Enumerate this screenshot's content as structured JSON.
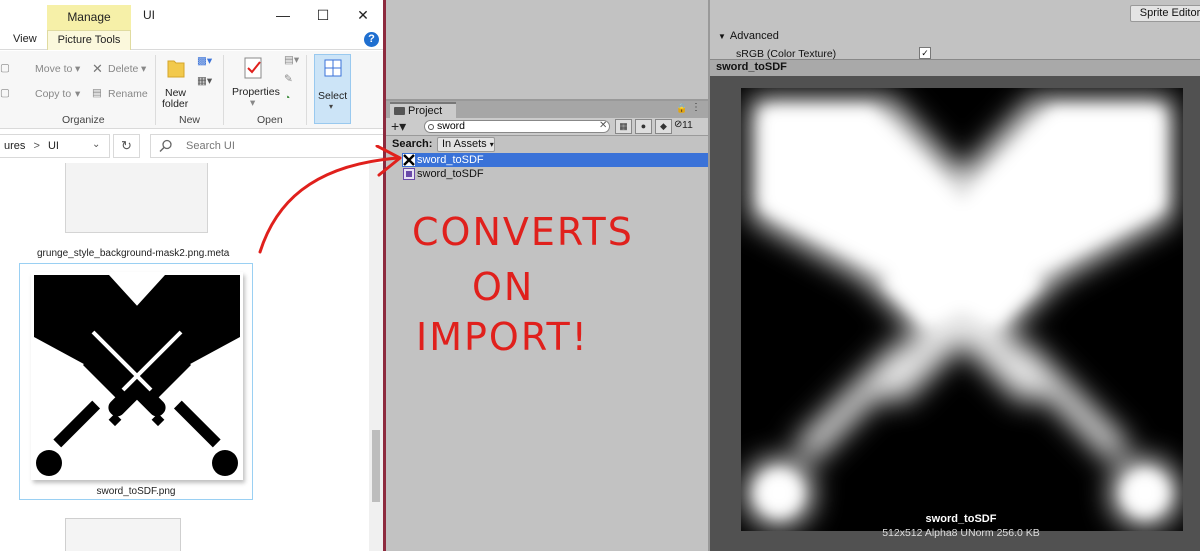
{
  "explorer": {
    "manage_tab": "Manage",
    "title": "UI",
    "tabs": {
      "view": "View",
      "picture_tools": "Picture Tools"
    },
    "ribbon": {
      "move_to": "Move to",
      "copy_to": "Copy to",
      "delete": "Delete",
      "rename": "Rename",
      "new_folder_line1": "New",
      "new_folder_line2": "folder",
      "properties": "Properties",
      "select": "Select",
      "groups": {
        "organize": "Organize",
        "new": "New",
        "open": "Open"
      }
    },
    "address": {
      "path_tail": "ures",
      "sep": ">",
      "current": "UI"
    },
    "search_placeholder": "Search UI",
    "files": [
      {
        "name": "grunge_style_background-mask2.png.meta"
      },
      {
        "name": "sword_toSDF.png"
      }
    ]
  },
  "unity": {
    "project": {
      "tab": "Project",
      "search_value": "sword",
      "hidden_count": "11",
      "search_label": "Search:",
      "scope": "In Assets",
      "assets": [
        {
          "name": "sword_toSDF",
          "selected": true
        },
        {
          "name": "sword_toSDF",
          "selected": false
        }
      ]
    },
    "annotation": {
      "line1": "CONVERTS",
      "line2": "ON",
      "line3": "IMPORT!"
    },
    "inspector": {
      "sprite_editor": "Sprite Editor",
      "advanced": "Advanced",
      "srgb": "sRGB (Color Texture)",
      "srgb_checked": true,
      "preview_title": "sword_toSDF",
      "preview_name": "sword_toSDF",
      "preview_info": "512x512  Alpha8 UNorm  256.0 KB"
    }
  },
  "colors": {
    "accent": "#3a72d8",
    "annotation": "#e0201c",
    "manage": "#f6f0a8"
  }
}
